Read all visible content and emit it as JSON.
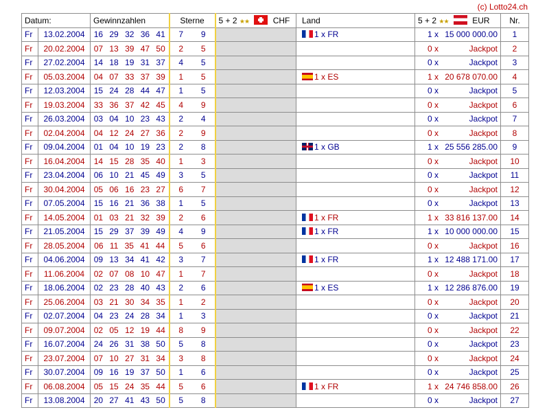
{
  "copyright": "(c) Lotto24.ch",
  "headers": {
    "datum": "Datum:",
    "gewinnzahlen": "Gewinnzahlen",
    "sterne": "Sterne",
    "chf_prefix": "5 + 2",
    "chf_label": "CHF",
    "land": "Land",
    "eur_prefix": "5 + 2",
    "eur_label": "EUR",
    "nr": "Nr."
  },
  "rows": [
    {
      "day": "Fr",
      "date": "13.02.2004",
      "numbers": "16 29 32 36 41",
      "star1": "7",
      "star2": "9",
      "flag": "fr",
      "land": "1 x FR",
      "count": "1 x",
      "amount": "15 000 000.00",
      "nr": "1"
    },
    {
      "day": "Fr",
      "date": "20.02.2004",
      "numbers": "07 13 39 47 50",
      "star1": "2",
      "star2": "5",
      "flag": "",
      "land": "",
      "count": "0 x",
      "amount": "Jackpot",
      "nr": "2"
    },
    {
      "day": "Fr",
      "date": "27.02.2004",
      "numbers": "14 18 19 31 37",
      "star1": "4",
      "star2": "5",
      "flag": "",
      "land": "",
      "count": "0 x",
      "amount": "Jackpot",
      "nr": "3"
    },
    {
      "day": "Fr",
      "date": "05.03.2004",
      "numbers": "04 07 33 37 39",
      "star1": "1",
      "star2": "5",
      "flag": "es",
      "land": "1 x ES",
      "count": "1 x",
      "amount": "20 678 070.00",
      "nr": "4"
    },
    {
      "day": "Fr",
      "date": "12.03.2004",
      "numbers": "15 24 28 44 47",
      "star1": "1",
      "star2": "5",
      "flag": "",
      "land": "",
      "count": "0 x",
      "amount": "Jackpot",
      "nr": "5"
    },
    {
      "day": "Fr",
      "date": "19.03.2004",
      "numbers": "33 36 37 42 45",
      "star1": "4",
      "star2": "9",
      "flag": "",
      "land": "",
      "count": "0 x",
      "amount": "Jackpot",
      "nr": "6"
    },
    {
      "day": "Fr",
      "date": "26.03.2004",
      "numbers": "03 04 10 23 43",
      "star1": "2",
      "star2": "4",
      "flag": "",
      "land": "",
      "count": "0 x",
      "amount": "Jackpot",
      "nr": "7"
    },
    {
      "day": "Fr",
      "date": "02.04.2004",
      "numbers": "04 12 24 27 36",
      "star1": "2",
      "star2": "9",
      "flag": "",
      "land": "",
      "count": "0 x",
      "amount": "Jackpot",
      "nr": "8"
    },
    {
      "day": "Fr",
      "date": "09.04.2004",
      "numbers": "01 04 10 19 23",
      "star1": "2",
      "star2": "8",
      "flag": "gb",
      "land": "1 x GB",
      "count": "1 x",
      "amount": "25 556 285.00",
      "nr": "9"
    },
    {
      "day": "Fr",
      "date": "16.04.2004",
      "numbers": "14 15 28 35 40",
      "star1": "1",
      "star2": "3",
      "flag": "",
      "land": "",
      "count": "0 x",
      "amount": "Jackpot",
      "nr": "10"
    },
    {
      "day": "Fr",
      "date": "23.04.2004",
      "numbers": "06 10 21 45 49",
      "star1": "3",
      "star2": "5",
      "flag": "",
      "land": "",
      "count": "0 x",
      "amount": "Jackpot",
      "nr": "11"
    },
    {
      "day": "Fr",
      "date": "30.04.2004",
      "numbers": "05 06 16 23 27",
      "star1": "6",
      "star2": "7",
      "flag": "",
      "land": "",
      "count": "0 x",
      "amount": "Jackpot",
      "nr": "12"
    },
    {
      "day": "Fr",
      "date": "07.05.2004",
      "numbers": "15 16 21 36 38",
      "star1": "1",
      "star2": "5",
      "flag": "",
      "land": "",
      "count": "0 x",
      "amount": "Jackpot",
      "nr": "13"
    },
    {
      "day": "Fr",
      "date": "14.05.2004",
      "numbers": "01 03 21 32 39",
      "star1": "2",
      "star2": "6",
      "flag": "fr",
      "land": "1 x FR",
      "count": "1 x",
      "amount": "33 816 137.00",
      "nr": "14"
    },
    {
      "day": "Fr",
      "date": "21.05.2004",
      "numbers": "15 29 37 39 49",
      "star1": "4",
      "star2": "9",
      "flag": "fr",
      "land": "1 x FR",
      "count": "1 x",
      "amount": "10 000 000.00",
      "nr": "15"
    },
    {
      "day": "Fr",
      "date": "28.05.2004",
      "numbers": "06 11 35 41 44",
      "star1": "5",
      "star2": "6",
      "flag": "",
      "land": "",
      "count": "0 x",
      "amount": "Jackpot",
      "nr": "16"
    },
    {
      "day": "Fr",
      "date": "04.06.2004",
      "numbers": "09 13 34 41 42",
      "star1": "3",
      "star2": "7",
      "flag": "fr",
      "land": "1 x FR",
      "count": "1 x",
      "amount": "12 488 171.00",
      "nr": "17"
    },
    {
      "day": "Fr",
      "date": "11.06.2004",
      "numbers": "02 07 08 10 47",
      "star1": "1",
      "star2": "7",
      "flag": "",
      "land": "",
      "count": "0 x",
      "amount": "Jackpot",
      "nr": "18"
    },
    {
      "day": "Fr",
      "date": "18.06.2004",
      "numbers": "02 23 28 40 43",
      "star1": "2",
      "star2": "6",
      "flag": "es",
      "land": "1 x ES",
      "count": "1 x",
      "amount": "12 286 876.00",
      "nr": "19"
    },
    {
      "day": "Fr",
      "date": "25.06.2004",
      "numbers": "03 21 30 34 35",
      "star1": "1",
      "star2": "2",
      "flag": "",
      "land": "",
      "count": "0 x",
      "amount": "Jackpot",
      "nr": "20"
    },
    {
      "day": "Fr",
      "date": "02.07.2004",
      "numbers": "04 23 24 28 34",
      "star1": "1",
      "star2": "3",
      "flag": "",
      "land": "",
      "count": "0 x",
      "amount": "Jackpot",
      "nr": "21"
    },
    {
      "day": "Fr",
      "date": "09.07.2004",
      "numbers": "02 05 12 19 44",
      "star1": "8",
      "star2": "9",
      "flag": "",
      "land": "",
      "count": "0 x",
      "amount": "Jackpot",
      "nr": "22"
    },
    {
      "day": "Fr",
      "date": "16.07.2004",
      "numbers": "24 26 31 38 50",
      "star1": "5",
      "star2": "8",
      "flag": "",
      "land": "",
      "count": "0 x",
      "amount": "Jackpot",
      "nr": "23"
    },
    {
      "day": "Fr",
      "date": "23.07.2004",
      "numbers": "07 10 27 31 34",
      "star1": "3",
      "star2": "8",
      "flag": "",
      "land": "",
      "count": "0 x",
      "amount": "Jackpot",
      "nr": "24"
    },
    {
      "day": "Fr",
      "date": "30.07.2004",
      "numbers": "09 16 19 37 50",
      "star1": "1",
      "star2": "6",
      "flag": "",
      "land": "",
      "count": "0 x",
      "amount": "Jackpot",
      "nr": "25"
    },
    {
      "day": "Fr",
      "date": "06.08.2004",
      "numbers": "05 15 24 35 44",
      "star1": "5",
      "star2": "6",
      "flag": "fr",
      "land": "1 x FR",
      "count": "1 x",
      "amount": "24 746 858.00",
      "nr": "26"
    },
    {
      "day": "Fr",
      "date": "13.08.2004",
      "numbers": "20 27 41 43 50",
      "star1": "5",
      "star2": "8",
      "flag": "",
      "land": "",
      "count": "0 x",
      "amount": "Jackpot",
      "nr": "27"
    }
  ],
  "colors": {
    "odd_row": "#000090",
    "even_row": "#b00000",
    "chf_background": "#dcdcdc",
    "stars_border": "#f0d040"
  }
}
